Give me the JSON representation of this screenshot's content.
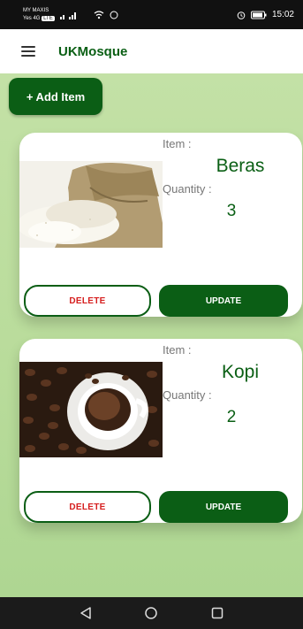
{
  "status_bar": {
    "carrier_line1": "MY MAXIS",
    "carrier_line2": "Yes 4G",
    "carrier_badge": "LTE",
    "signal": "..‥‥",
    "time": "15:02",
    "battery": "80"
  },
  "app_bar": {
    "title": "UKMosque"
  },
  "toolbar": {
    "add_label": "+ Add Item"
  },
  "items": [
    {
      "item_label": "Item :",
      "name": "Beras",
      "quantity_label": "Quantity :",
      "quantity": "3",
      "delete_label": "DELETE",
      "update_label": "UPDATE",
      "image": "rice-sack"
    },
    {
      "item_label": "Item :",
      "name": "Kopi",
      "quantity_label": "Quantity :",
      "quantity": "2",
      "delete_label": "DELETE",
      "update_label": "UPDATE",
      "image": "coffee-cup"
    }
  ],
  "colors": {
    "primary": "#0b5e15",
    "background": "#bfe0a3",
    "delete_text": "#d61e1e"
  },
  "nav": {
    "icons": [
      "back-icon",
      "home-icon",
      "recents-icon"
    ]
  }
}
